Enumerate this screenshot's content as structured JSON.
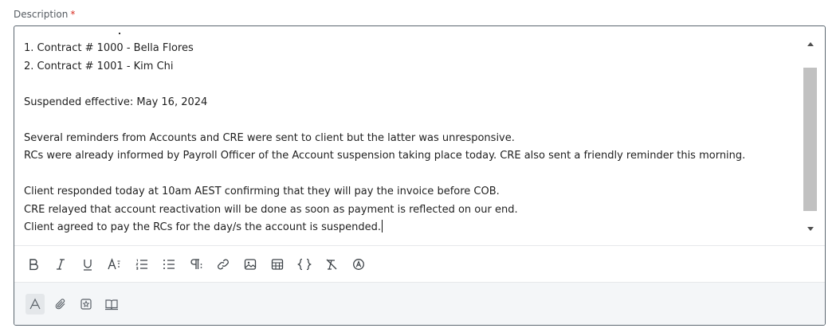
{
  "field": {
    "label": "Description",
    "required_mark": "*"
  },
  "editor": {
    "lines": [
      "1. Contract # 1000 - Bella Flores",
      "2. Contract # 1001 - Kim Chi",
      "",
      "Suspended effective: May 16, 2024",
      "",
      "Several reminders from Accounts and CRE were sent to client but the latter was unresponsive.",
      "RCs were already informed by Payroll Officer of the Account suspension taking place today. CRE also sent a friendly reminder this morning.",
      "",
      "Client responded today at 10am AEST confirming that they will pay the invoice before COB.",
      "CRE relayed that account reactivation will be done as soon as payment is reflected on our end.",
      "Client agreed to pay the RCs for the day/s the account is suspended."
    ]
  },
  "toolbar": {
    "icons": [
      "bold-icon",
      "italic-icon",
      "underline-icon",
      "text-size-icon",
      "numbered-list-icon",
      "bulleted-list-icon",
      "paragraph-icon",
      "link-icon",
      "image-icon",
      "table-icon",
      "code-icon",
      "clear-format-icon",
      "ai-assist-icon"
    ]
  },
  "footer": {
    "icons": [
      "text-mode-icon",
      "attachment-icon",
      "snippet-icon",
      "knowledge-book-icon"
    ]
  },
  "colors": {
    "border": "#5b6670",
    "required": "#d93025",
    "footer_bg": "#f4f6f8",
    "scroll_thumb": "#c1c1c1"
  }
}
